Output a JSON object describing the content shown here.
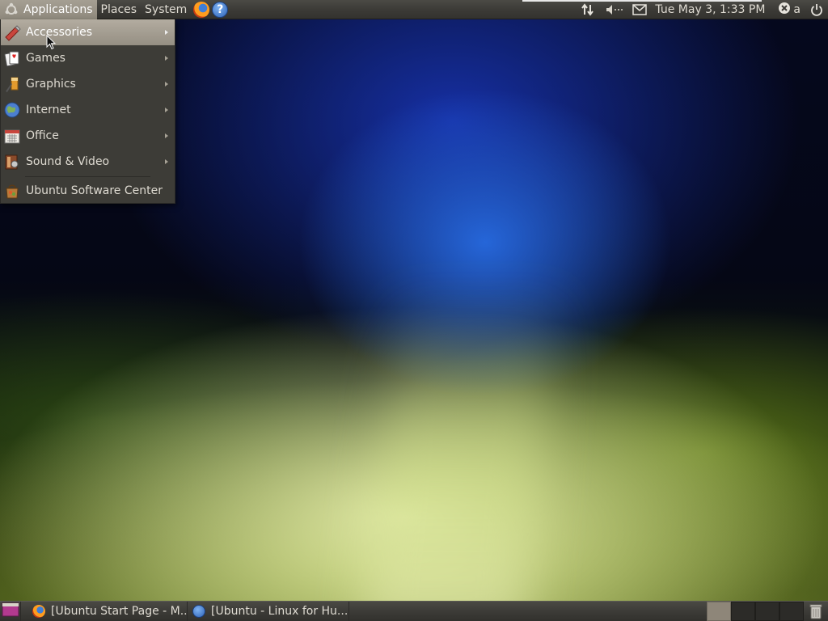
{
  "top_panel": {
    "menus": [
      {
        "label": "Applications",
        "active": true
      },
      {
        "label": "Places",
        "active": false
      },
      {
        "label": "System",
        "active": false
      }
    ],
    "launchers": [
      {
        "icon": "firefox-icon"
      },
      {
        "icon": "help-icon",
        "glyph": "?"
      }
    ],
    "tray": {
      "network_icon": "network-arrows-icon",
      "volume_icon": "volume-muted-icon",
      "mail_icon": "mail-envelope-icon",
      "clock": "Tue May  3,  1:33 PM",
      "user_status_icon": "user-offline-icon",
      "user_name": "a",
      "power_icon": "power-icon"
    }
  },
  "applications_menu": {
    "items": [
      {
        "label": "Accessories",
        "icon": "accessories-icon",
        "submenu": true,
        "highlighted": true
      },
      {
        "label": "Games",
        "icon": "games-cards-icon",
        "submenu": true,
        "highlighted": false
      },
      {
        "label": "Graphics",
        "icon": "graphics-brush-icon",
        "submenu": true,
        "highlighted": false
      },
      {
        "label": "Internet",
        "icon": "internet-globe-icon",
        "submenu": true,
        "highlighted": false
      },
      {
        "label": "Office",
        "icon": "office-calendar-icon",
        "submenu": true,
        "highlighted": false
      },
      {
        "label": "Sound & Video",
        "icon": "sound-video-icon",
        "submenu": true,
        "highlighted": false
      }
    ],
    "footer_item": {
      "label": "Ubuntu Software Center",
      "icon": "software-center-icon"
    }
  },
  "bottom_panel": {
    "show_desktop_icon": "show-desktop-icon",
    "tasks": [
      {
        "label": "[Ubuntu Start Page - M...",
        "icon": "firefox-icon"
      },
      {
        "label": "[Ubuntu - Linux for Hu...",
        "icon": "help-icon"
      }
    ],
    "workspaces": [
      {
        "active": true
      },
      {
        "active": false
      },
      {
        "active": false
      },
      {
        "active": false
      }
    ],
    "trash_icon": "trash-icon"
  },
  "colors": {
    "panel": "#3b3a36",
    "menu_background": "#3d3c37",
    "menu_highlight": "#a59f93",
    "text": "#dfdbd2"
  }
}
